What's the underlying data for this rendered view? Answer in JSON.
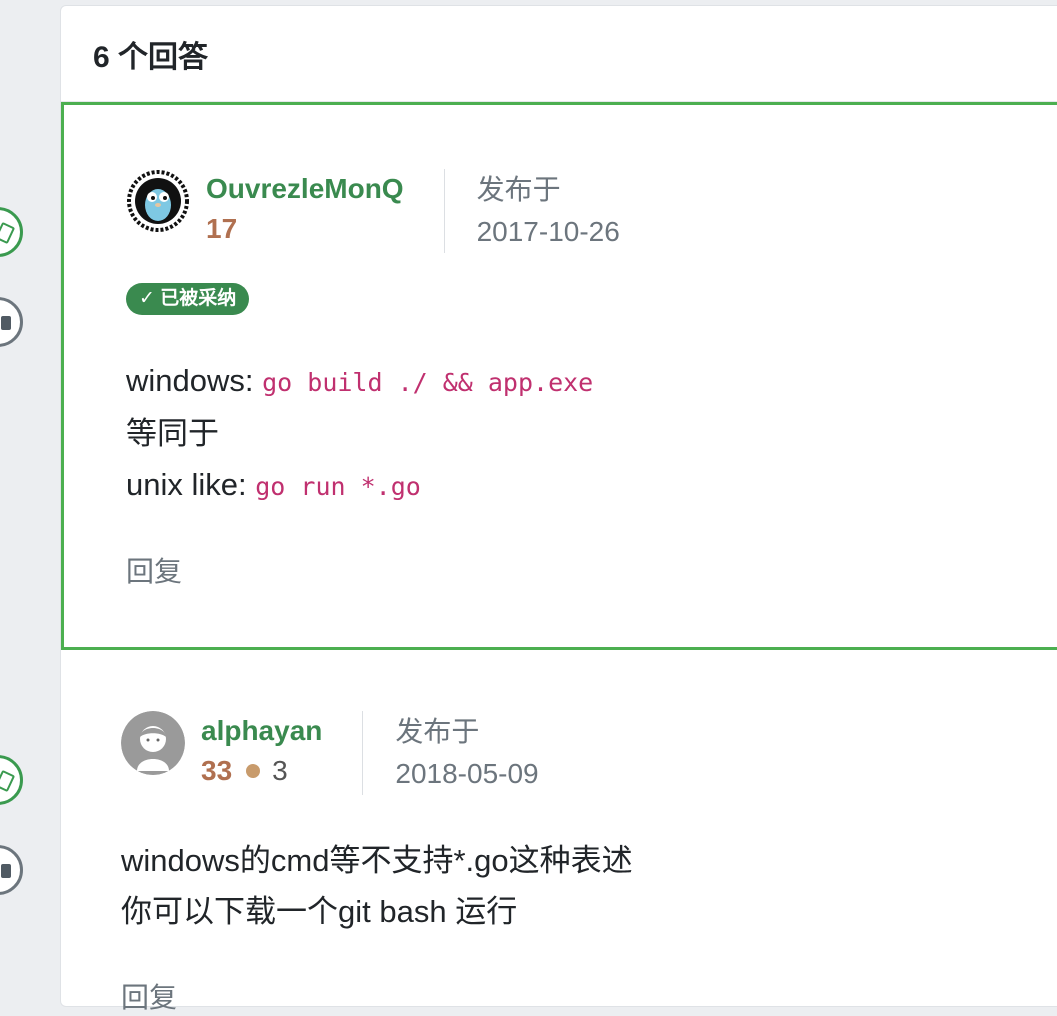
{
  "header": {
    "title": "6 个回答"
  },
  "answers": [
    {
      "username": "OuvrezleMonQ",
      "reputation": "17",
      "date_label": "发布于",
      "date": "2017-10-26",
      "accepted_label": "✓ 已被采纳",
      "body": {
        "line1_prefix": "windows: ",
        "line1_code": "go build ./ && app.exe",
        "line2": "等同于",
        "line3_prefix": "unix like: ",
        "line3_code": "go run *.go"
      },
      "reply_label": "回复"
    },
    {
      "username": "alphayan",
      "reputation": "33",
      "bronze_badges": "3",
      "date_label": "发布于",
      "date": "2018-05-09",
      "body": {
        "line1": "windows的cmd等不支持*.go这种表述",
        "line2": "你可以下载一个git bash 运行"
      },
      "reply_label": "回复"
    }
  ],
  "icons": {
    "vote": "thumb-up-icon",
    "bookmark": "bookmark-icon",
    "avatar_1": "gopher-avatar",
    "avatar_2": "default-user-avatar"
  },
  "colors": {
    "accent_green": "#3a8a4f",
    "accepted_border": "#4caf50",
    "reputation": "#b07050",
    "code": "#c0306f",
    "bronze": "#c89b6c"
  }
}
